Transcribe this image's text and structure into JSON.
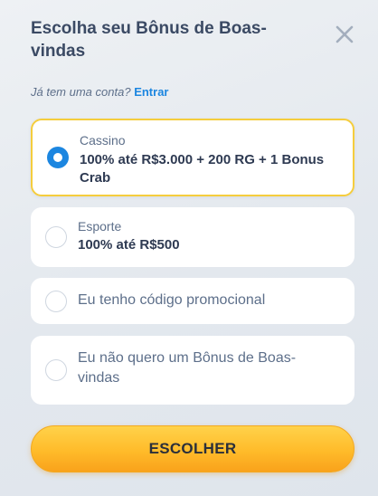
{
  "modal": {
    "title": "Escolha seu Bônus de Boas-vindas",
    "close_icon": "close-icon"
  },
  "login": {
    "prompt": "Já tem uma conta?",
    "link": "Entrar"
  },
  "options": [
    {
      "category": "Cassino",
      "label": "100% até R$3.000 + 200 RG + 1 Bonus Crab",
      "selected": true
    },
    {
      "category": "Esporte",
      "label": "100% até R$500",
      "selected": false
    },
    {
      "label": "Eu tenho código promocional",
      "selected": false
    },
    {
      "label": "Eu não quero um Bônus de Boas-vindas",
      "selected": false
    }
  ],
  "cta": {
    "label": "ESCOLHER"
  },
  "colors": {
    "accent": "#1c86e0",
    "selected_border": "#f5cd3d",
    "button": "#ffbb2a",
    "title": "#3b4a64"
  }
}
